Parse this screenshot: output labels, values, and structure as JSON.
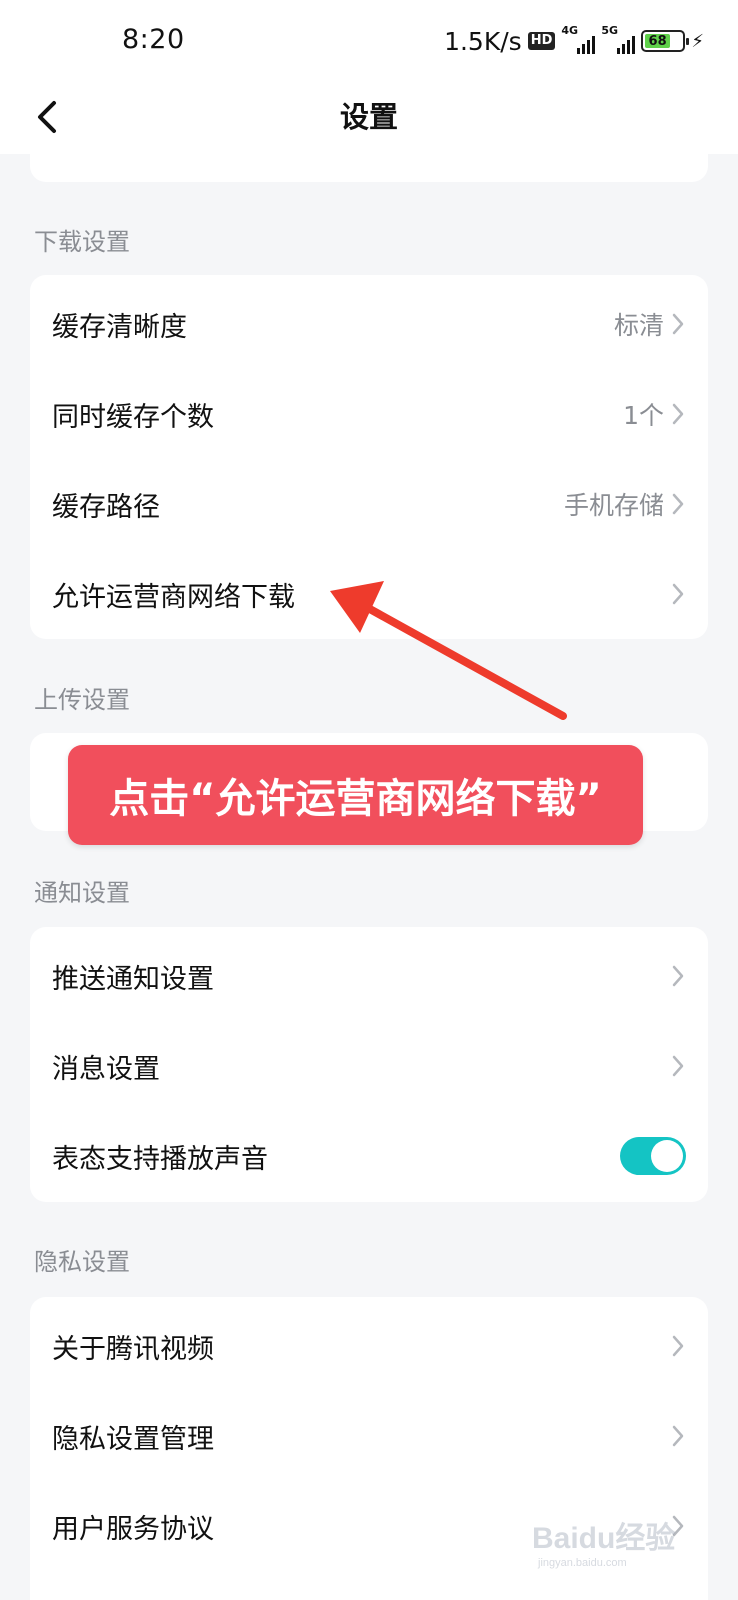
{
  "status_bar": {
    "time": "8:20",
    "net_speed": "1.5K/s",
    "hd_badge": "HD",
    "signal_1_tag": "4G",
    "signal_2_tag": "5G",
    "battery_level": "68"
  },
  "nav": {
    "title": "设置"
  },
  "sections": {
    "download": {
      "header": "下载设置",
      "rows": [
        {
          "label": "缓存清晰度",
          "value": "标清"
        },
        {
          "label": "同时缓存个数",
          "value": "1个"
        },
        {
          "label": "缓存路径",
          "value": "手机存储"
        },
        {
          "label": "允许运营商网络下载",
          "value": ""
        }
      ]
    },
    "upload": {
      "header": "上传设置"
    },
    "notify": {
      "header": "通知设置",
      "rows": [
        {
          "label": "推送通知设置"
        },
        {
          "label": "消息设置"
        },
        {
          "label": "表态支持播放声音",
          "toggle_on": true
        }
      ]
    },
    "privacy": {
      "header": "隐私设置",
      "rows": [
        {
          "label": "关于腾讯视频"
        },
        {
          "label": "隐私设置管理"
        },
        {
          "label": "用户服务协议"
        }
      ]
    }
  },
  "annotation": {
    "text": "点击“允许运营商网络下载”",
    "color": "#f14f5c"
  },
  "colors": {
    "accent_toggle": "#14c4c4",
    "section_text": "#8a8d93",
    "background": "#f5f6f8"
  },
  "watermark": {
    "text": "Baidu经验",
    "subtext": "jingyan.baidu.com"
  }
}
